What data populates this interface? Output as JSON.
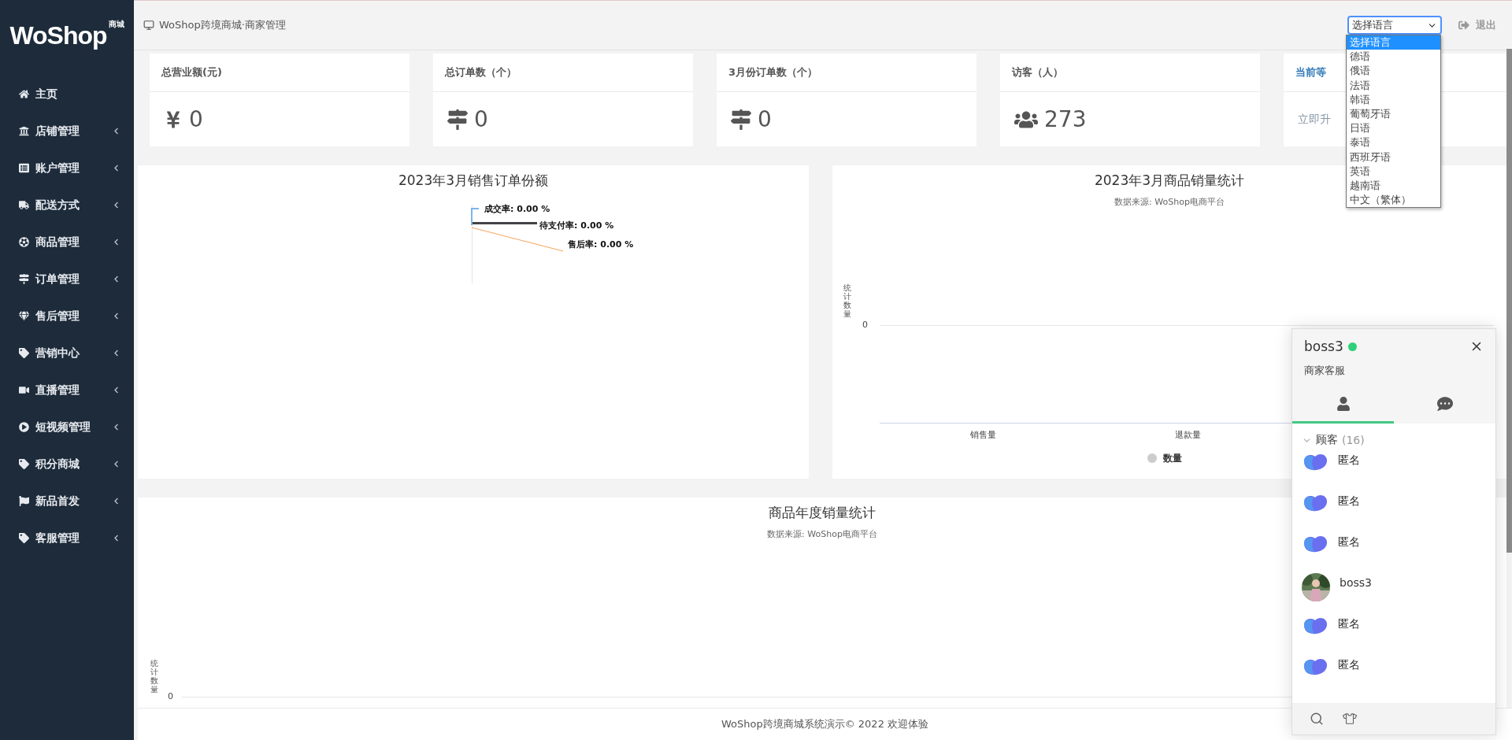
{
  "sidebar": {
    "logo": {
      "text": "WoShop",
      "badge": "商城"
    },
    "items": [
      {
        "label": "主页",
        "has_children": false
      },
      {
        "label": "店铺管理",
        "has_children": true
      },
      {
        "label": "账户管理",
        "has_children": true
      },
      {
        "label": "配送方式",
        "has_children": true
      },
      {
        "label": "商品管理",
        "has_children": true
      },
      {
        "label": "订单管理",
        "has_children": true
      },
      {
        "label": "售后管理",
        "has_children": true
      },
      {
        "label": "营销中心",
        "has_children": true
      },
      {
        "label": "直播管理",
        "has_children": true
      },
      {
        "label": "短视频管理",
        "has_children": true
      },
      {
        "label": "积分商城",
        "has_children": true
      },
      {
        "label": "新品首发",
        "has_children": true
      },
      {
        "label": "客服管理",
        "has_children": true
      }
    ]
  },
  "topbar": {
    "breadcrumb": "WoShop跨境商城·商家管理",
    "language_select": {
      "value": "选择语言",
      "expanded": true,
      "options": [
        {
          "label": "选择语言",
          "selected": true
        },
        {
          "label": "德语",
          "selected": false
        },
        {
          "label": "俄语",
          "selected": false
        },
        {
          "label": "法语",
          "selected": false
        },
        {
          "label": "韩语",
          "selected": false
        },
        {
          "label": "葡萄牙语",
          "selected": false
        },
        {
          "label": "日语",
          "selected": false
        },
        {
          "label": "泰语",
          "selected": false
        },
        {
          "label": "西班牙语",
          "selected": false
        },
        {
          "label": "英语",
          "selected": false
        },
        {
          "label": "越南语",
          "selected": false
        },
        {
          "label": "中文（繁体）",
          "selected": false
        }
      ]
    },
    "logout": "退出"
  },
  "stats": [
    {
      "title": "总营业额(元)",
      "value": "0",
      "kind": "money"
    },
    {
      "title": "总订单数（个）",
      "value": "0",
      "kind": "orders"
    },
    {
      "title": "3月份订单数（个）",
      "value": "0",
      "kind": "orders"
    },
    {
      "title": "访客（人）",
      "value": "273",
      "kind": "visitors"
    },
    {
      "title": "当前等",
      "value": "立即升",
      "kind": "link"
    }
  ],
  "pie_panel": {
    "title": "2023年3月销售订单份额",
    "labels": [
      {
        "text": "成交率: 0.00 %",
        "color": "#7cb5ec"
      },
      {
        "text": "待支付率: 0.00 %",
        "color": "#434348"
      },
      {
        "text": "售后率: 0.00 %",
        "color": "#f7a35c"
      }
    ]
  },
  "bar_panel": {
    "title": "2023年3月商品销量统计",
    "subtitle": "数据来源: WoShop电商平台",
    "y_label": "统计数量",
    "y_tick": "0",
    "categories": [
      "销售量",
      "退款量"
    ],
    "legend": {
      "name": "数量",
      "color": "#cccccc"
    }
  },
  "yearly_panel": {
    "title": "商品年度销量统计",
    "subtitle": "数据来源: WoShop电商平台",
    "y_label": "统计数量",
    "y_tick": "0"
  },
  "footer": "WoShop跨境商城系统演示© 2022 欢迎体验",
  "chat": {
    "name": "boss3",
    "online": true,
    "role": "商家客服",
    "tabs": [
      {
        "selected": true
      },
      {
        "selected": false
      }
    ],
    "group": {
      "label": "顾客",
      "count": "(16)",
      "expanded": true
    },
    "contacts": [
      {
        "name": "匿名",
        "kind": "logo"
      },
      {
        "name": "匿名",
        "kind": "logo"
      },
      {
        "name": "匿名",
        "kind": "logo"
      },
      {
        "name": "boss3"
      },
      {
        "name": "匿名",
        "kind": "logo"
      },
      {
        "name": "匿名",
        "kind": "logo"
      }
    ]
  }
}
